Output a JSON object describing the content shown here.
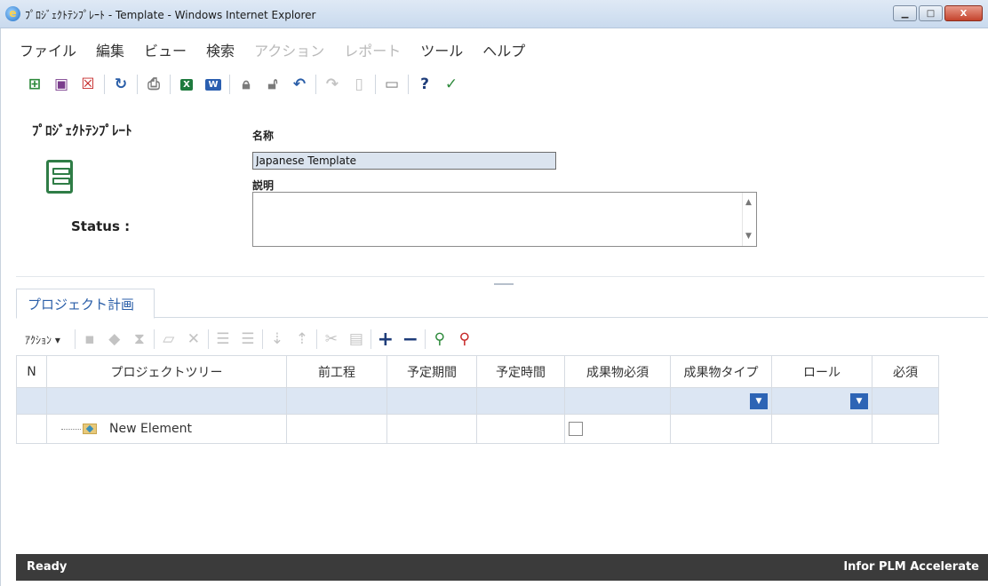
{
  "window": {
    "title": "ﾌﾟﾛｼﾞｪｸﾄﾃﾝﾌﾟﾚｰﾄ - Template - Windows Internet Explorer",
    "minimize_symbol": "▁",
    "maximize_symbol": "□",
    "close_symbol": "X"
  },
  "menu": [
    {
      "label": "ファイル",
      "enabled": true
    },
    {
      "label": "編集",
      "enabled": true
    },
    {
      "label": "ビュー",
      "enabled": true
    },
    {
      "label": "検索",
      "enabled": true
    },
    {
      "label": "アクション",
      "enabled": false
    },
    {
      "label": "レポート",
      "enabled": false
    },
    {
      "label": "ツール",
      "enabled": true
    },
    {
      "label": "ヘルプ",
      "enabled": true
    }
  ],
  "toolbar": {
    "icons": [
      "new-icon",
      "save-icon",
      "delete-icon",
      "refresh-icon",
      "print-icon",
      "excel-icon",
      "word-icon",
      "lock-icon",
      "unlock-icon",
      "undo-icon",
      "redo-icon",
      "document-icon",
      "panel-icon",
      "help-icon",
      "check-icon"
    ],
    "excel_badge": "X",
    "word_badge": "W",
    "help_symbol": "?",
    "check_symbol": "✓"
  },
  "form": {
    "heading": "ﾌﾟﾛｼﾞｪｸﾄﾃﾝﾌﾟﾚｰﾄ",
    "name_label": "名称",
    "name_value": "Japanese Template",
    "description_label": "説明",
    "description_value": "",
    "status_label": "Status :"
  },
  "tabs": [
    {
      "label": "プロジェクト計画",
      "active": true
    }
  ],
  "grid_toolbar": {
    "action_menu_label": "ｱｸｼｮﾝ ▾"
  },
  "grid": {
    "columns": [
      "N",
      "プロジェクトツリー",
      "前工程",
      "予定期間",
      "予定時間",
      "成果物必須",
      "成果物タイプ",
      "ロール",
      "必須"
    ],
    "rows": [
      {
        "n": "",
        "tree": "New Element",
        "predecessor": "",
        "planned_period": "",
        "planned_time": "",
        "deliverable_required": false,
        "deliverable_type": "",
        "role": "",
        "required": ""
      }
    ]
  },
  "status": {
    "left": "Ready",
    "right": "Infor PLM Accelerate"
  },
  "colors": {
    "accent": "#2d64b5",
    "status_bar": "#3b3b3b",
    "filter_row": "#dce6f3",
    "template_icon": "#2f7d46"
  }
}
